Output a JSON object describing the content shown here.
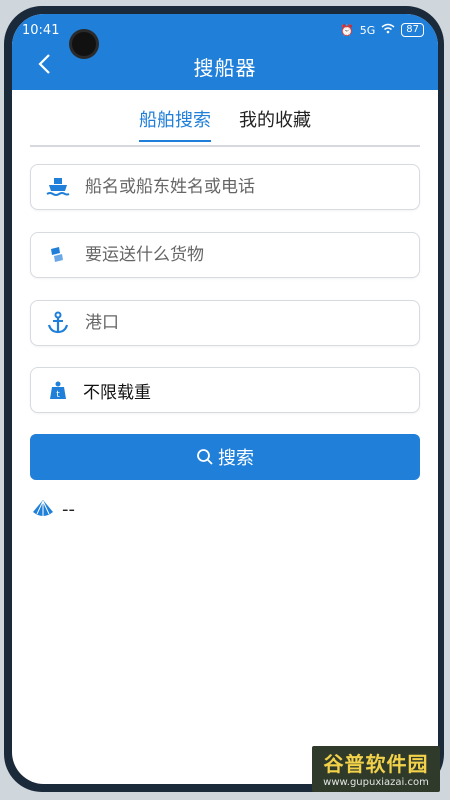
{
  "status_bar": {
    "time": "10:41",
    "network": "5G",
    "battery": "87"
  },
  "header": {
    "title": "搜船器"
  },
  "tabs": [
    {
      "label": "船舶搜索",
      "active": true
    },
    {
      "label": "我的收藏",
      "active": false
    }
  ],
  "fields": {
    "ship": {
      "placeholder": "船名或船东姓名或电话",
      "icon": "ship-icon"
    },
    "cargo": {
      "placeholder": "要运送什么货物",
      "icon": "cargo-icon"
    },
    "port": {
      "placeholder": "港口",
      "icon": "anchor-icon"
    },
    "tonnage": {
      "value": "不限载重",
      "icon": "weight-icon"
    }
  },
  "search_button": {
    "label": "搜索",
    "icon": "search-icon"
  },
  "result": {
    "text": "--",
    "icon": "shell-icon"
  },
  "watermark": {
    "title": "谷普软件园",
    "url": "www.gupuxiazai.com"
  },
  "colors": {
    "accent": "#1f7fd9",
    "background": "#ffffff",
    "divider": "#d6d9dd"
  }
}
